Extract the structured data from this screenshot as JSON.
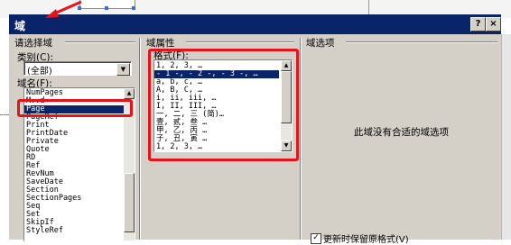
{
  "dialog": {
    "title": "域",
    "help_label": "?",
    "close_label": "×"
  },
  "left": {
    "section_title": "请选择域",
    "category_label": "类别(C):",
    "category_value": "(全部)",
    "fieldname_label": "域名(F):",
    "fieldnames": [
      "NumPages",
      "M..d",
      "Page",
      "PageRef",
      "Print",
      "PrintDate",
      "Private",
      "Quote",
      "RD",
      "Ref",
      "RevNum",
      "SaveDate",
      "Section",
      "SectionPages",
      "Seq",
      "Set",
      "SkipIf",
      "StyleRef"
    ],
    "selected_index": 2
  },
  "middle": {
    "section_title": "域属性",
    "format_label": "格式(F):",
    "formats": [
      "1, 2, 3, …",
      "- 1 -, - 2 -, - 3 -, …",
      "a, b, c, …",
      "A, B, C, …",
      "i, ii, iii, …",
      "I, II, III, …",
      "一, 二, 三 (简)…",
      "壹, 贰, 叁 …",
      "甲, 乙, 丙 …",
      "子, 丑, 寅 …",
      "1, 2, 3, …"
    ],
    "selected_index": 1
  },
  "right": {
    "section_title": "域选项",
    "no_options_text": "此域没有合适的域选项",
    "preserve_format_checked": true,
    "preserve_format_label": "更新时保留原格式(V)"
  },
  "annotation_color": "#e8121a",
  "title_bar_color": "#0a246a"
}
